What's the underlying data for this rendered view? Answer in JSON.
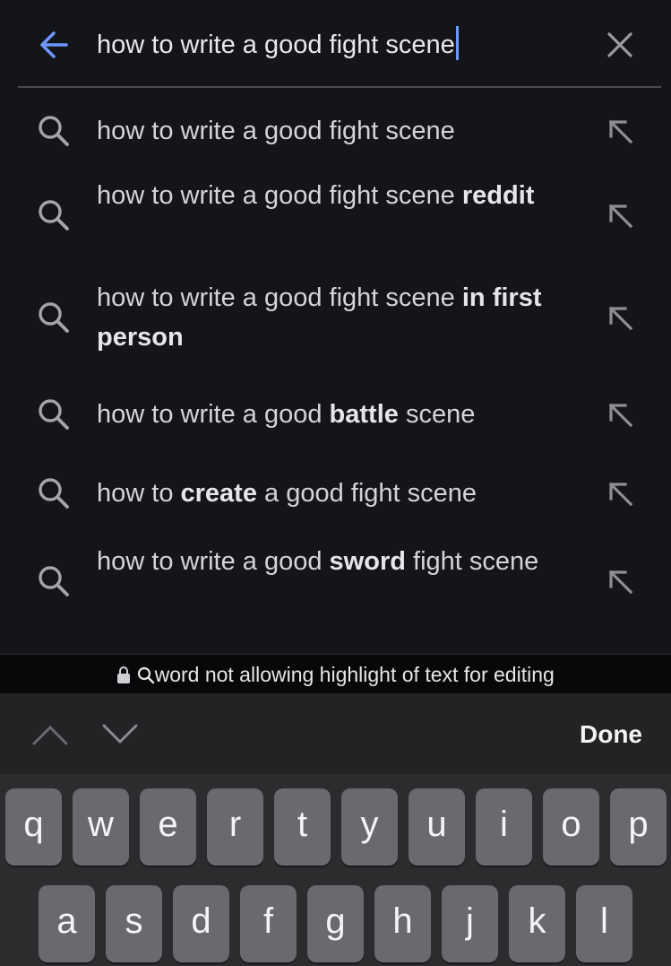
{
  "search": {
    "query": "how to write a good fight scene"
  },
  "suggestions": [
    {
      "parts": [
        {
          "t": "how to write a good fight scene",
          "b": false
        }
      ]
    },
    {
      "parts": [
        {
          "t": "how to write a good fight scene ",
          "b": false
        },
        {
          "t": "reddit",
          "b": true
        }
      ]
    },
    {
      "parts": [
        {
          "t": "how to write a good fight scene ",
          "b": false
        },
        {
          "t": "in first person",
          "b": true
        }
      ]
    },
    {
      "parts": [
        {
          "t": "how to write a good ",
          "b": false
        },
        {
          "t": "battle",
          "b": true
        },
        {
          "t": " scene",
          "b": false
        }
      ]
    },
    {
      "parts": [
        {
          "t": "how to ",
          "b": false
        },
        {
          "t": "create",
          "b": true
        },
        {
          "t": " a good fight scene",
          "b": false
        }
      ]
    },
    {
      "parts": [
        {
          "t": "how to write a good ",
          "b": false
        },
        {
          "t": "sword",
          "b": true
        },
        {
          "t": " fight scene",
          "b": false
        }
      ]
    }
  ],
  "notice": {
    "text": "word not allowing highlight of text for editing"
  },
  "accessory": {
    "done_label": "Done"
  },
  "keyboard": {
    "row1": [
      "q",
      "w",
      "e",
      "r",
      "t",
      "y",
      "u",
      "i",
      "o",
      "p"
    ],
    "row2": [
      "a",
      "s",
      "d",
      "f",
      "g",
      "h",
      "j",
      "k",
      "l"
    ]
  },
  "colors": {
    "background": "#14151a",
    "accent": "#6f97ff",
    "key": "#6a6a6e"
  }
}
